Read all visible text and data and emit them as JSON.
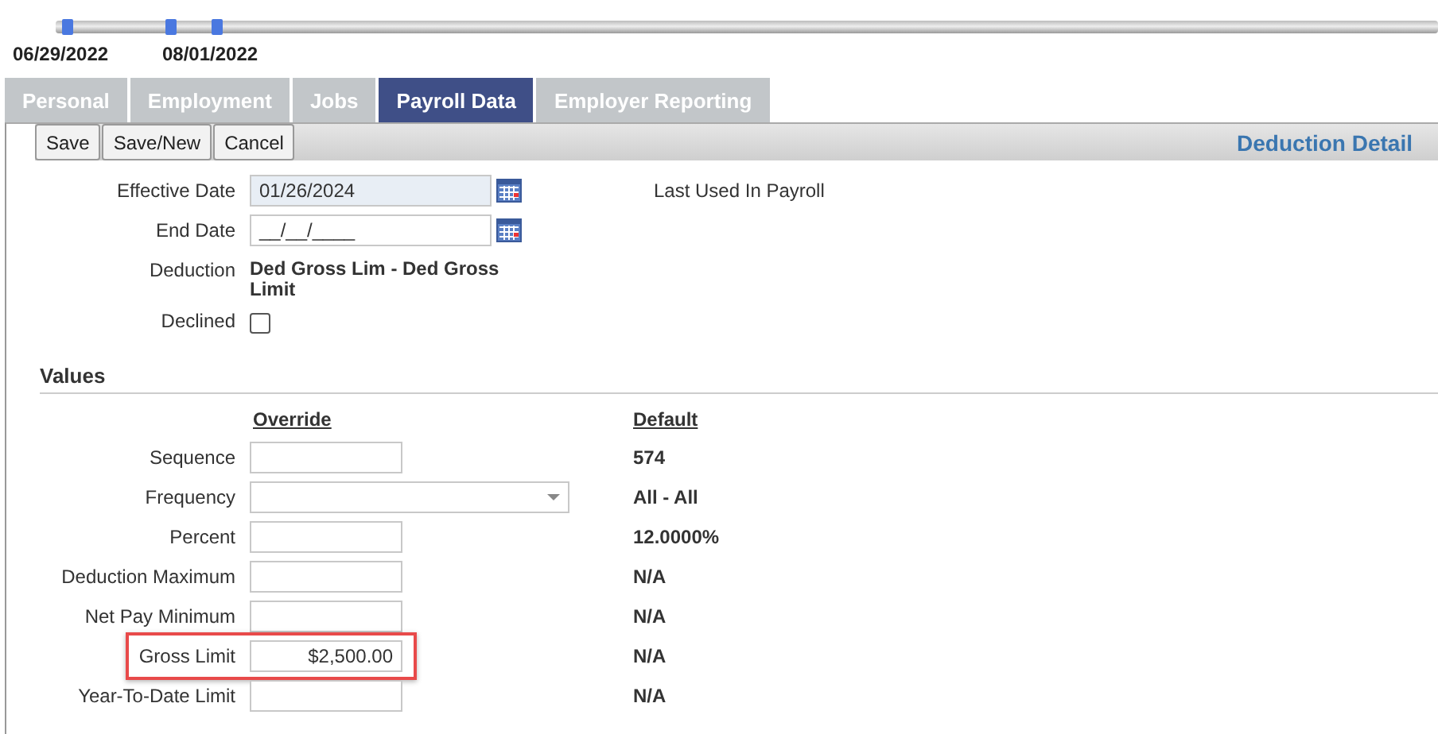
{
  "timeline": {
    "dates": [
      "06/29/2022",
      "08/01/2022"
    ]
  },
  "tabs": [
    {
      "label": "Personal",
      "selected": false
    },
    {
      "label": "Employment",
      "selected": false
    },
    {
      "label": "Jobs",
      "selected": false
    },
    {
      "label": "Payroll Data",
      "selected": true
    },
    {
      "label": "Employer Reporting",
      "selected": false
    }
  ],
  "toolbar": {
    "buttons": [
      "Save",
      "Save/New",
      "Cancel"
    ],
    "title": "Deduction Detail"
  },
  "fields": [
    {
      "kind": "date",
      "label": "Effective Date",
      "value": "01/26/2024",
      "disabled": true
    },
    {
      "kind": "date",
      "label": "End Date",
      "value": "__/__/____",
      "disabled": false
    },
    {
      "kind": "text",
      "label": "Deduction",
      "value": "Ded Gross Lim - Ded Gross Limit"
    },
    {
      "kind": "checkbox",
      "label": "Declined",
      "checked": false
    }
  ],
  "last_used_label": "Last Used In Payroll",
  "values": {
    "title": "Values",
    "override_header": "Override",
    "default_header": "Default",
    "rows": [
      {
        "kind": "input",
        "label": "Sequence",
        "value": "",
        "default": "574",
        "highlighted": false
      },
      {
        "kind": "select",
        "label": "Frequency",
        "value": "",
        "default": "All - All",
        "highlighted": false
      },
      {
        "kind": "input",
        "label": "Percent",
        "value": "",
        "default": "12.0000%",
        "highlighted": false
      },
      {
        "kind": "input",
        "label": "Deduction Maximum",
        "value": "",
        "default": "N/A",
        "highlighted": false
      },
      {
        "kind": "input",
        "label": "Net Pay Minimum",
        "value": "",
        "default": "N/A",
        "highlighted": false
      },
      {
        "kind": "input",
        "label": "Gross Limit",
        "value": "$2,500.00",
        "default": "N/A",
        "highlighted": true
      },
      {
        "kind": "input",
        "label": "Year-To-Date Limit",
        "value": "",
        "default": "N/A",
        "highlighted": false
      }
    ]
  }
}
